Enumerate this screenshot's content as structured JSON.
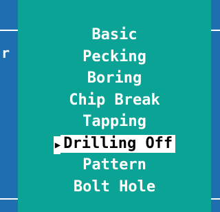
{
  "background": {
    "left_edge_text": "r"
  },
  "menu": {
    "items": [
      {
        "label": "Basic",
        "selected": false
      },
      {
        "label": "Pecking",
        "selected": false
      },
      {
        "label": "Boring",
        "selected": false
      },
      {
        "label": "Chip Break",
        "selected": false
      },
      {
        "label": "Tapping",
        "selected": false
      },
      {
        "label": "Drilling Off",
        "selected": true
      },
      {
        "label": "Pattern",
        "selected": false
      },
      {
        "label": "Bolt Hole",
        "selected": false
      }
    ],
    "pointer_icon": "right-triangle-pointer"
  },
  "colors": {
    "panel": "#0aa396",
    "window_bg": "#1f6fb0",
    "text": "#ffffff",
    "highlight_bg": "#ffffff",
    "highlight_text": "#000000"
  }
}
